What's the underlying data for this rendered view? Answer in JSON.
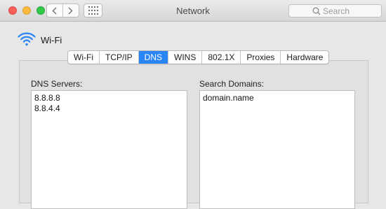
{
  "window": {
    "title": "Network"
  },
  "search": {
    "placeholder": "Search"
  },
  "interface": {
    "name": "Wi-Fi"
  },
  "tabs": [
    {
      "label": "Wi-Fi",
      "active": false
    },
    {
      "label": "TCP/IP",
      "active": false
    },
    {
      "label": "DNS",
      "active": true
    },
    {
      "label": "WINS",
      "active": false
    },
    {
      "label": "802.1X",
      "active": false
    },
    {
      "label": "Proxies",
      "active": false
    },
    {
      "label": "Hardware",
      "active": false
    }
  ],
  "dns_servers": {
    "label": "DNS Servers:",
    "items": [
      "8.8.8.8",
      "8.8.4.4"
    ]
  },
  "search_domains": {
    "label": "Search Domains:",
    "items": [
      "domain.name"
    ]
  },
  "colors": {
    "accent": "#2a86f7",
    "wifi_icon": "#2a86f7"
  }
}
